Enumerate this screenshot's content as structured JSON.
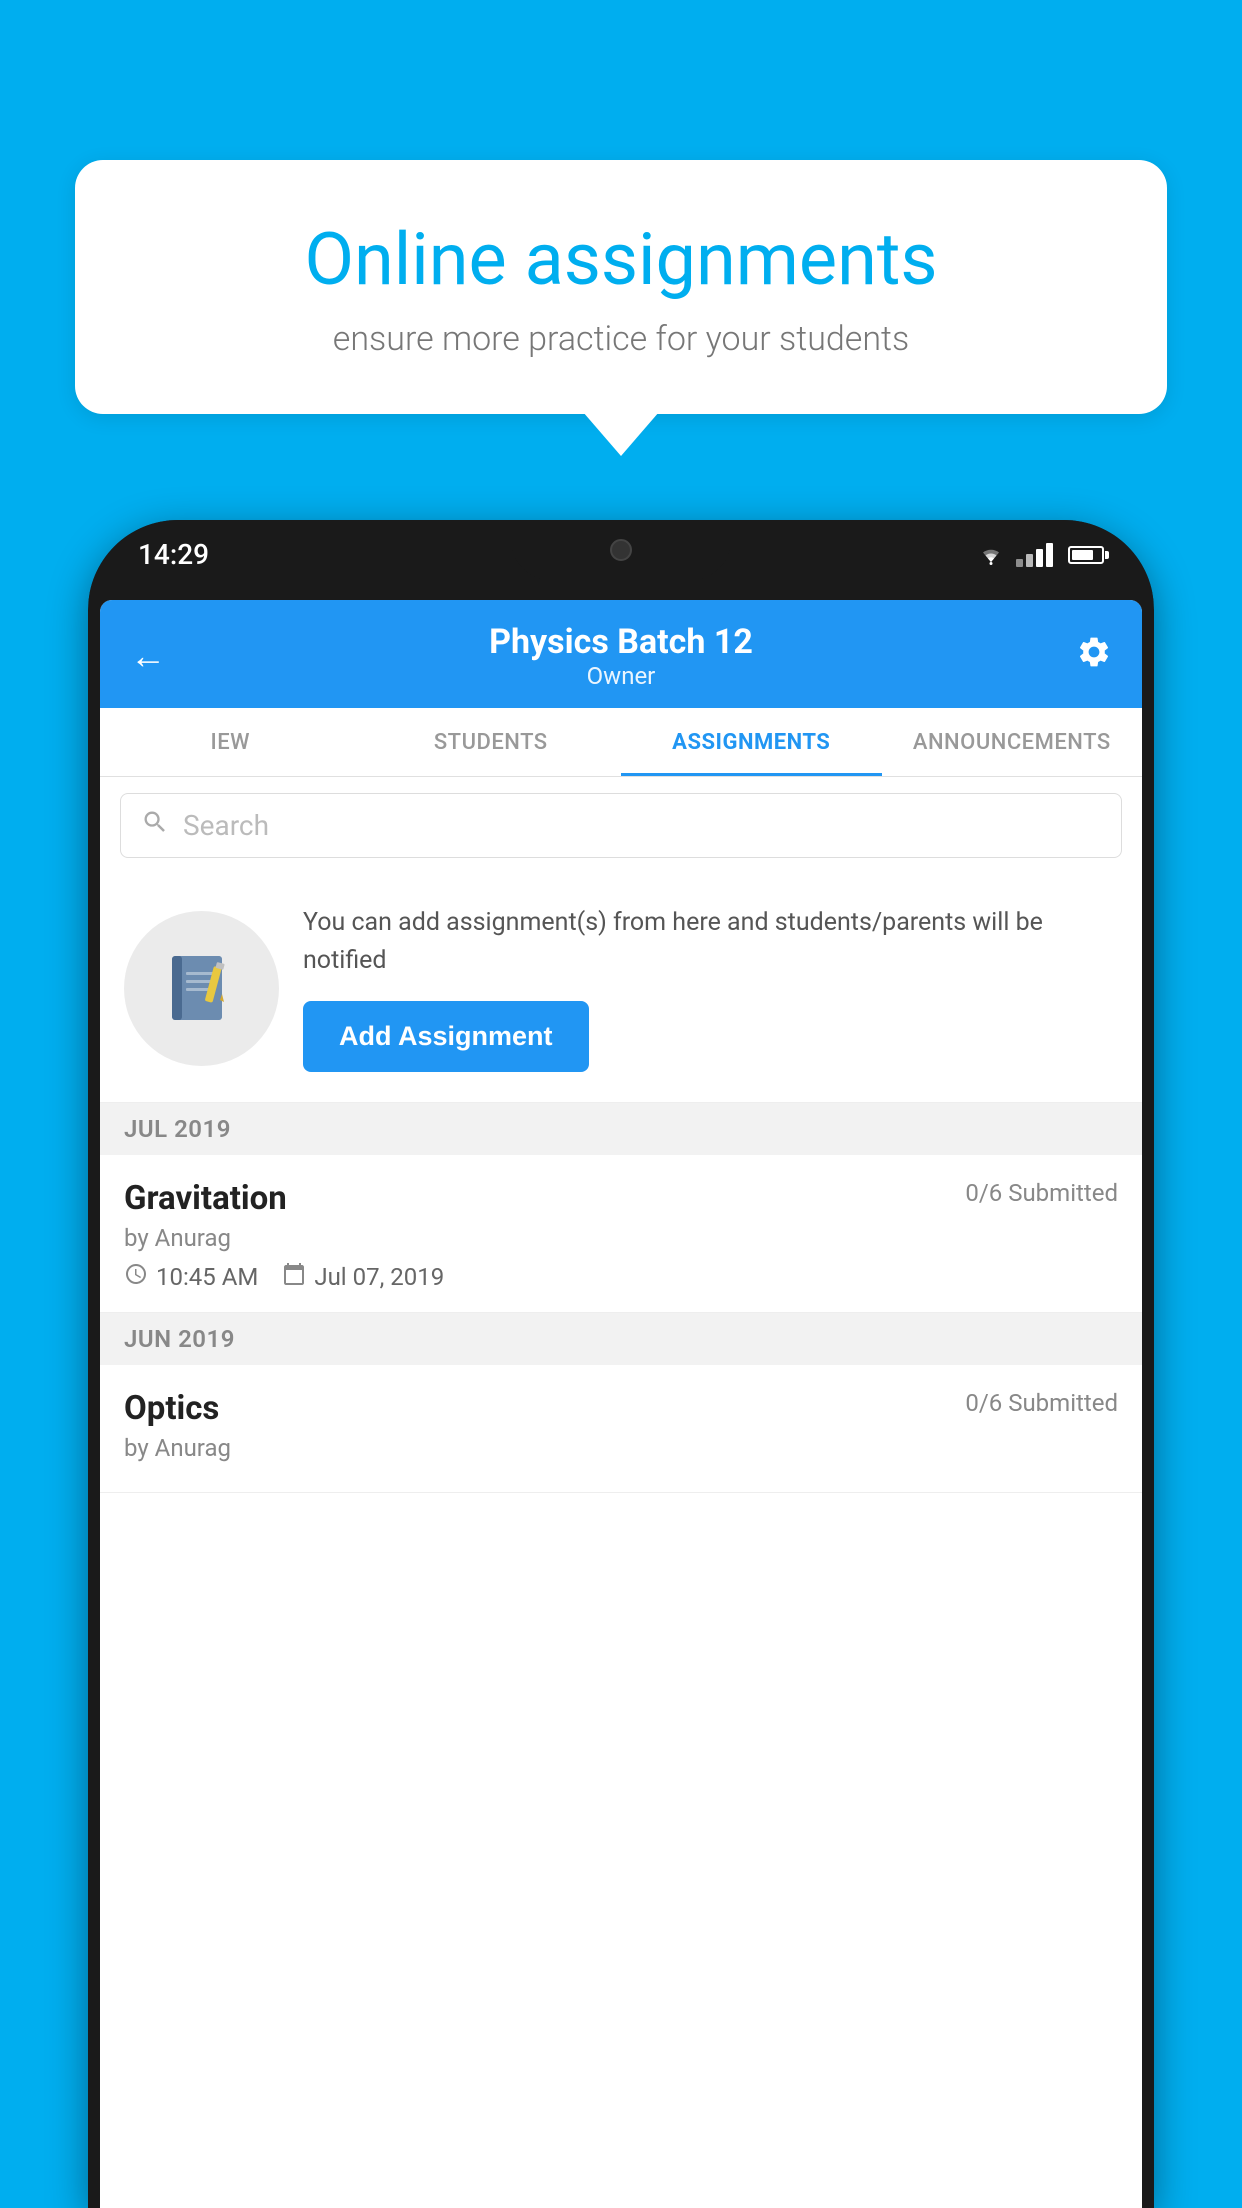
{
  "background_color": "#00AEEF",
  "speech_bubble": {
    "title": "Online assignments",
    "subtitle": "ensure more practice for your students"
  },
  "phone": {
    "status_bar": {
      "time": "14:29"
    },
    "header": {
      "title": "Physics Batch 12",
      "subtitle": "Owner",
      "back_label": "←",
      "settings_label": "⚙"
    },
    "tabs": [
      {
        "label": "IEW",
        "active": false
      },
      {
        "label": "STUDENTS",
        "active": false
      },
      {
        "label": "ASSIGNMENTS",
        "active": true
      },
      {
        "label": "ANNOUNCEMENTS",
        "active": false
      }
    ],
    "search": {
      "placeholder": "Search"
    },
    "info_card": {
      "description": "You can add assignment(s) from here and students/parents will be notified",
      "add_button_label": "Add Assignment"
    },
    "sections": [
      {
        "month": "JUL 2019",
        "assignments": [
          {
            "name": "Gravitation",
            "submitted": "0/6 Submitted",
            "by": "by Anurag",
            "time": "10:45 AM",
            "date": "Jul 07, 2019"
          }
        ]
      },
      {
        "month": "JUN 2019",
        "assignments": [
          {
            "name": "Optics",
            "submitted": "0/6 Submitted",
            "by": "by Anurag",
            "time": "",
            "date": ""
          }
        ]
      }
    ]
  }
}
